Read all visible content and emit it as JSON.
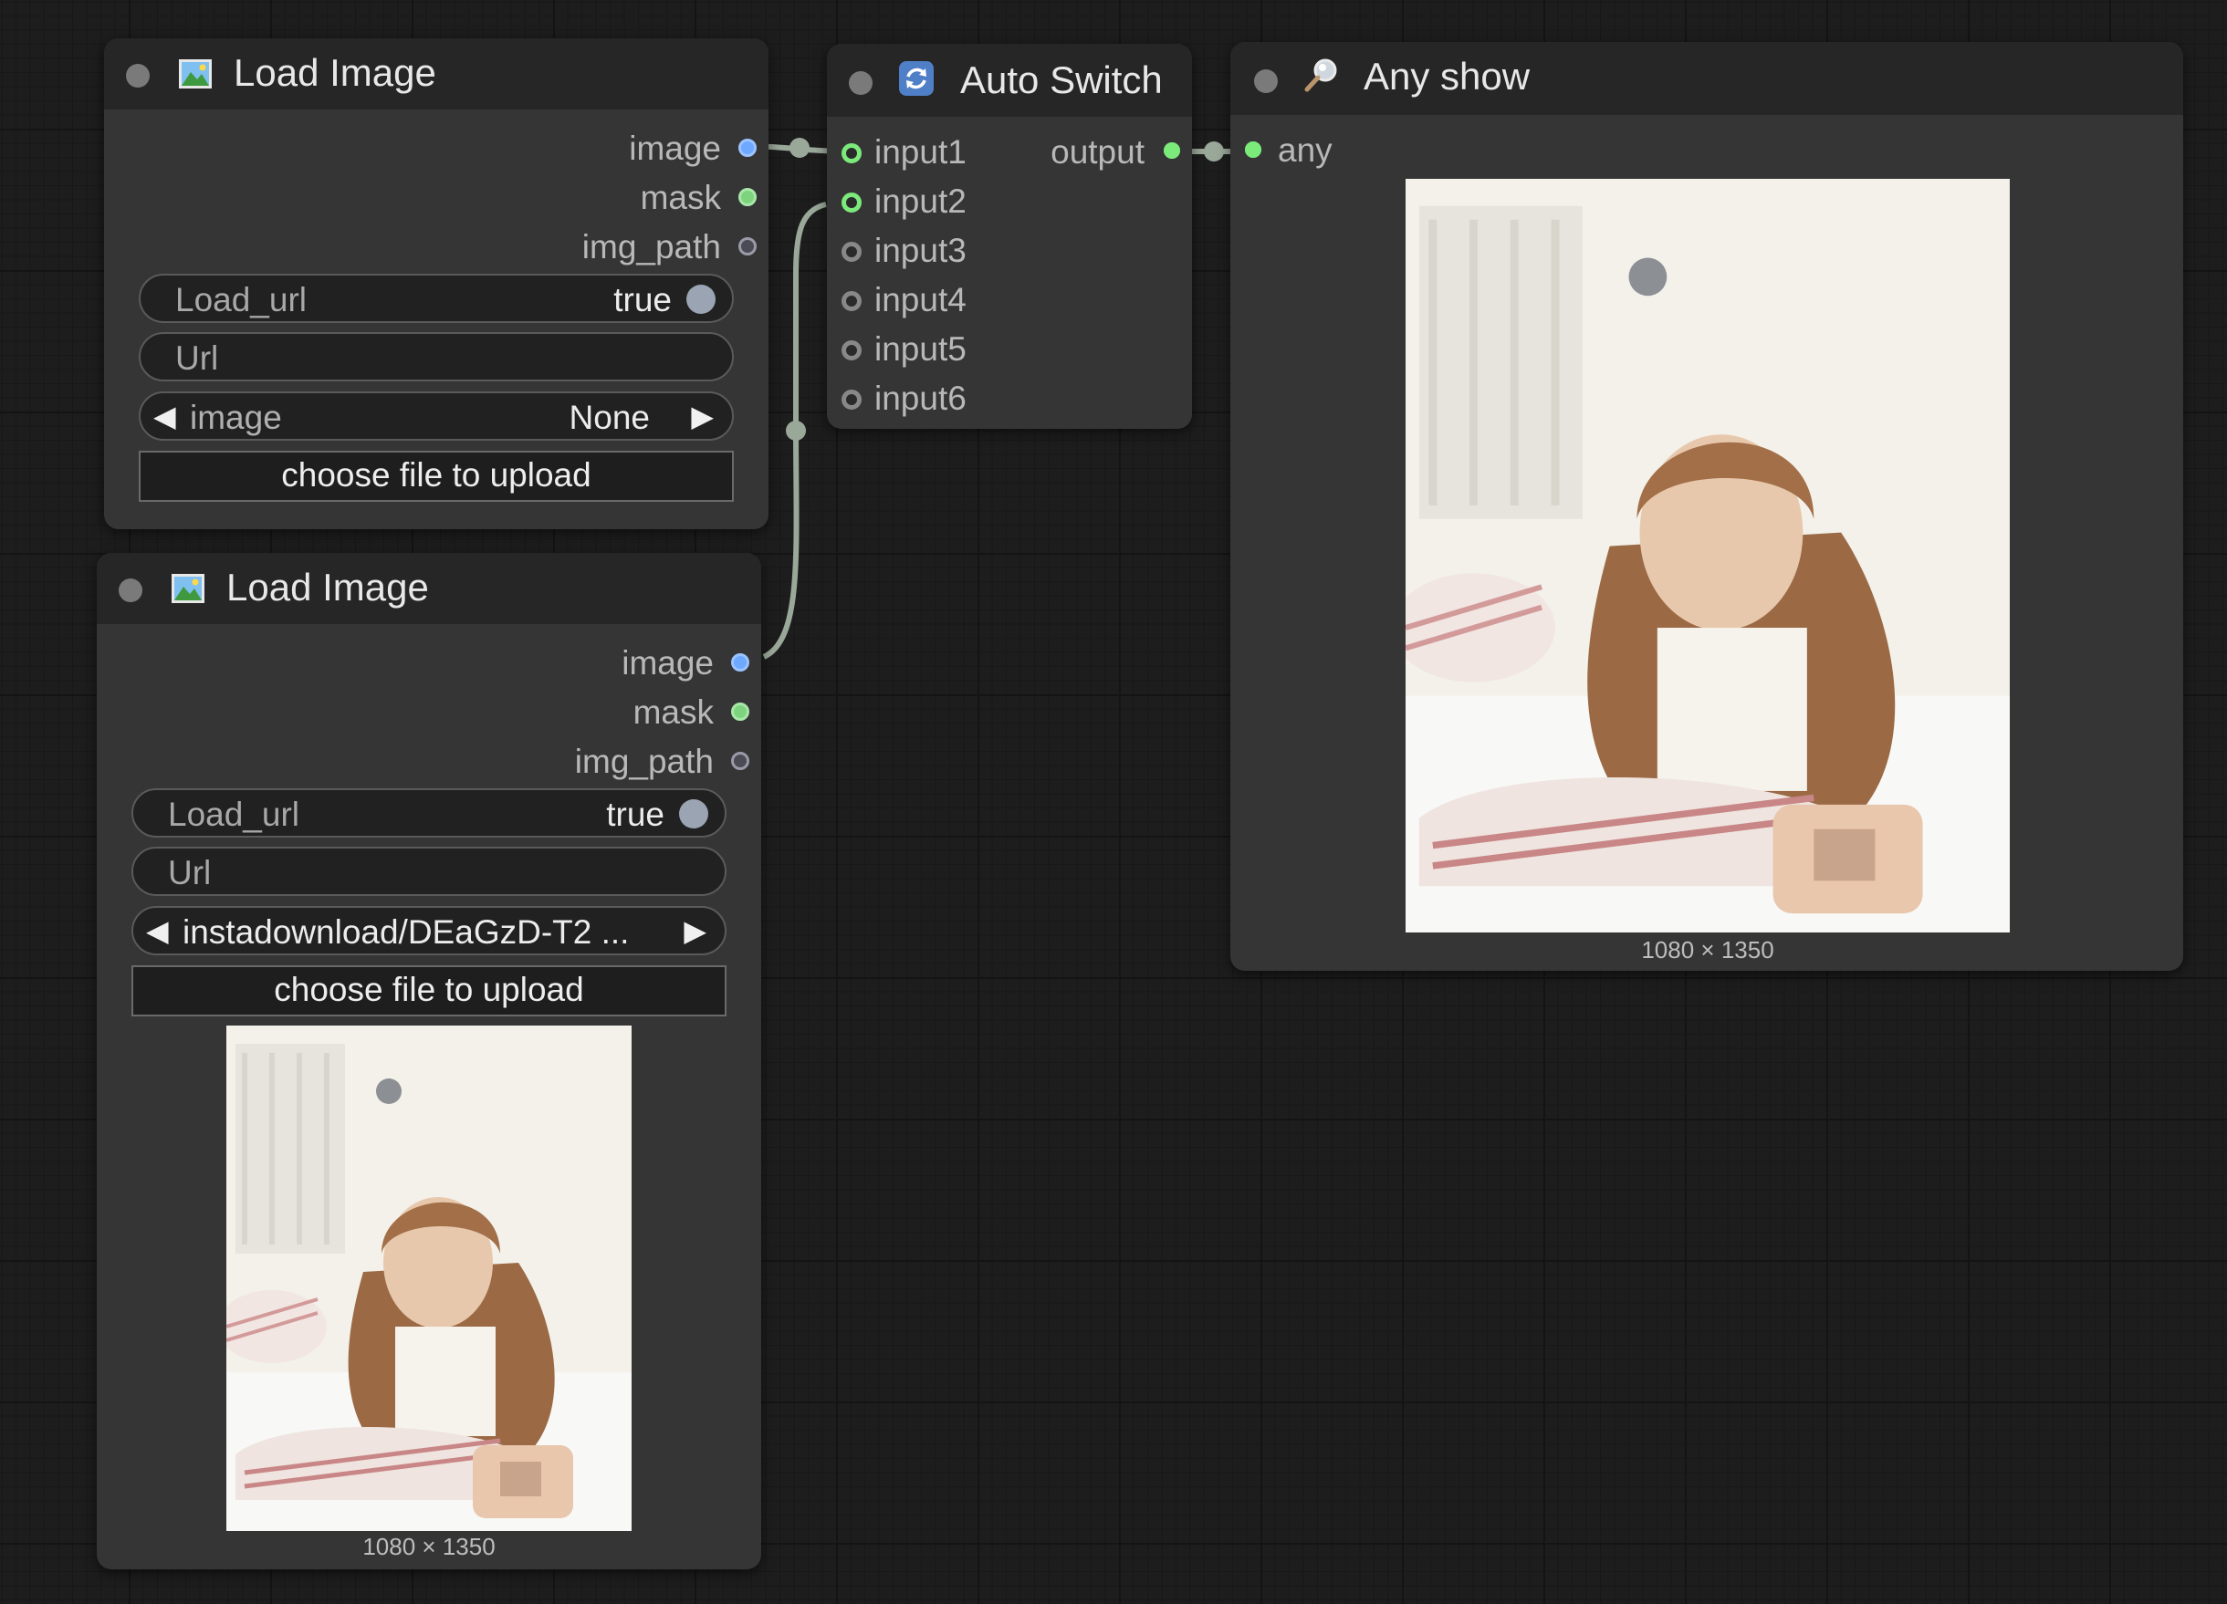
{
  "nodes": {
    "load1": {
      "title": "Load Image",
      "outputs": [
        "image",
        "mask",
        "img_path"
      ],
      "load_url_label": "Load_url",
      "load_url_value": "true",
      "url_label": "Url",
      "image_label": "image",
      "image_value": "None",
      "upload_label": "choose file to upload"
    },
    "load2": {
      "title": "Load Image",
      "outputs": [
        "image",
        "mask",
        "img_path"
      ],
      "load_url_label": "Load_url",
      "load_url_value": "true",
      "url_label": "Url",
      "image_value": "instadownload/DEaGzD-T2 ...",
      "upload_label": "choose file to upload",
      "preview_caption": "1080 × 1350"
    },
    "switch": {
      "title": "Auto Switch",
      "inputs": [
        "input1",
        "input2",
        "input3",
        "input4",
        "input5",
        "input6"
      ],
      "output": "output"
    },
    "show": {
      "title": "Any show",
      "input": "any",
      "preview_caption": "1080 × 1350"
    }
  },
  "icons": {
    "load_image": "picture-icon",
    "auto_switch": "refresh-icon",
    "any_show": "magnifier-icon"
  },
  "colors": {
    "image_slot": "#6fa8ff",
    "mask_slot": "#7ed47e",
    "active_slot": "#7bea7b",
    "link": "#9aa89a"
  }
}
